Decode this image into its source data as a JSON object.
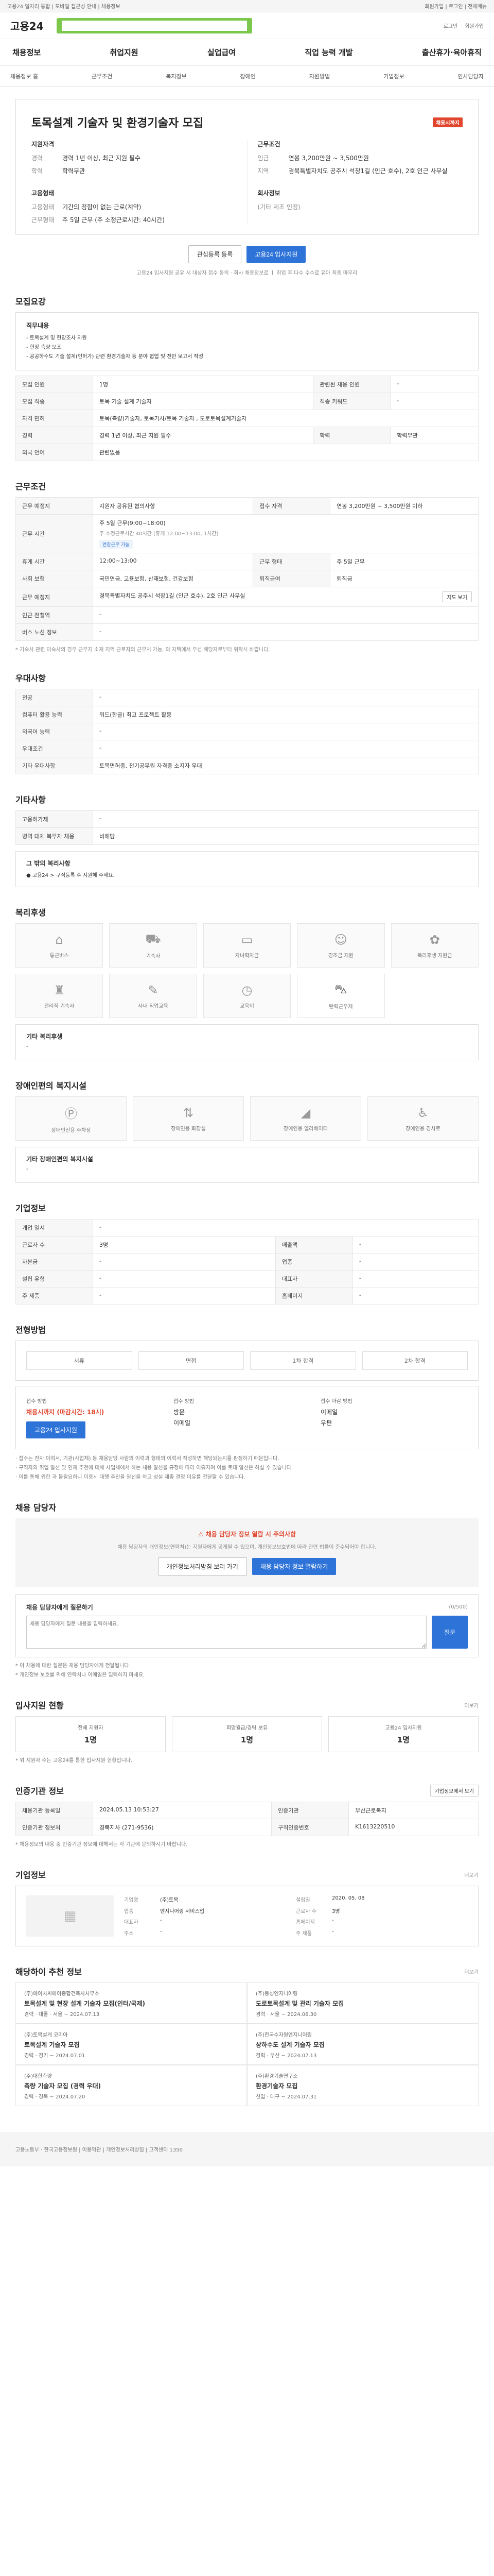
{
  "topbar": {
    "notice": "고용24 일자리 통합 | 모바일 접근성 안내 | 채용정보",
    "right": "회원가입 | 로그인 | 전체메뉴"
  },
  "site": {
    "logo": "고용24",
    "search_placeholder": "",
    "utils": [
      "로그인",
      "회원가입"
    ]
  },
  "gnb": [
    "채용정보",
    "취업지원",
    "실업급여",
    "직업 능력 개발",
    "출산휴가·육아휴직"
  ],
  "subnav": [
    "채용정보 홈",
    "근무조건",
    "복지정보",
    "장애인",
    "지원방법",
    "기업정보",
    "인사담당자"
  ],
  "job": {
    "title": "토목설계 기술자 및 환경기술자 모집",
    "badge": "채용시까지",
    "left_head": "지원자격",
    "left": [
      [
        "경력",
        "경력 1년 이상, 최근 지원 필수"
      ],
      [
        "학력",
        "학력무관"
      ]
    ],
    "right_head": "근무조건",
    "right": [
      [
        "임금",
        "연봉 3,200만원 ~ 3,500만원"
      ],
      [
        "지역",
        "경북특별자치도 공주시 석장1길 (인근 호수), 2호 인근 사무실"
      ]
    ],
    "left2_head": "고용형태",
    "left2": [
      [
        "고용형태",
        "기간의 정함이 없는 근로(계약)"
      ],
      [
        "근무형태",
        "주 5일 근무 (주 소정근로시간: 40시간)"
      ]
    ],
    "right2_head": "회사정보",
    "right2": [
      [
        "",
        "(기타 제조 인정)"
      ]
    ],
    "apply_label": "고용24 입사지원",
    "save_label": "관심등록 등록",
    "note": "고용24 입사지원 공유 시 대상자 접수 동의 · 회사 채용정보로 ㅣ 취업 후 다수 수수료 유아 최종 마무리"
  },
  "recruit": {
    "head": "모집요강",
    "duty_head": "직무내용",
    "duties": [
      "- 토목설계 및 현장조사 지원",
      "- 현장 측량 보조",
      "- 공공하수도 기술 설계(인허가) 관련 환경기술자 등 분야 협업 및 전반 보고서 작성"
    ],
    "rows": [
      [
        "모집 인원",
        "1명",
        "관련된 채용 인원",
        "-"
      ],
      [
        "모집 직종",
        "토목 기술 설계 기술자",
        "직종 키워드",
        "-"
      ],
      [
        "자격 면허",
        "토목(측량)기술자, 토목기사/토목 기술자 , 도로토목설계기술자",
        "",
        ""
      ],
      [
        "경력",
        "경력 1년 이상, 최근 지원 필수",
        "학력",
        "학력무관"
      ],
      [
        "외국 언어",
        "관련없음",
        "",
        ""
      ]
    ]
  },
  "work": {
    "head": "근무조건",
    "rows": [
      [
        "근무 예정지",
        "지원자 공유된 협의사항",
        "접수 자격",
        "연봉 3,200만원 ~ 3,500만원 이하"
      ],
      [
        "근무 시간",
        "주 5일 근무(9:00~18:00)",
        "",
        ""
      ],
      [
        "휴게 시간",
        "12:00~13:00",
        "근무 형태",
        "주 5일 근무"
      ],
      [
        "사회 보험",
        "국민연금, 고용보험, 산재보험, 건강보험",
        "퇴직급여",
        "퇴직금"
      ],
      [
        "근무 예정지",
        "경북특별자치도 공주시 석장1길 (인근 호수), 2호 인근 사무실",
        "",
        ""
      ],
      [
        "인근 전철역",
        "-",
        "",
        ""
      ],
      [
        "버스 노선 정보",
        "-",
        "",
        ""
      ]
    ],
    "sub_text": "주 소정근로시간 40시간 (휴게 12:00~13:00, 1시간)",
    "map_label": "지도 보기",
    "footnote": "* 기숙사 관련 미숙사의 경우 근무지 소재 지역 근로자의 근무처 가능, 의 자택에서 우선 해당자로부터 위탁시 바랍니다.",
    "pill_label": "연장근무 가능"
  },
  "etc": {
    "head": "우대사항",
    "rows": [
      [
        "전공",
        "-"
      ],
      [
        "컴퓨터 활용 능력",
        "워드(한글) 최고 프로젝트 활용"
      ],
      [
        "외국어 능력",
        "-"
      ],
      [
        "우대조건",
        "-"
      ],
      [
        "기타 우대사항",
        "토목면허증, 전기공무원 자격증 소지자 우대"
      ]
    ]
  },
  "other": {
    "head": "기타사항",
    "rows": [
      [
        "고용허가제",
        "-"
      ],
      [
        "병역 대체 복무자 채용",
        "비해당"
      ]
    ],
    "extra_head": "그 밖의 복리사항",
    "extra": "● 고용24 > 구직등록 후 지원해 주세요."
  },
  "welfare": {
    "head": "복리후생",
    "cards": [
      [
        "house-icon",
        "통근버스"
      ],
      [
        "car-icon",
        "기숙사"
      ],
      [
        "card-icon",
        "자녀학자금"
      ],
      [
        "baby-icon",
        "경조금 지원"
      ],
      [
        "gift-icon",
        "복리후생 지원금"
      ],
      [
        "shirt-icon",
        "관리직 기숙사"
      ],
      [
        "pen-icon",
        "사내 직업교육"
      ],
      [
        "clock-icon",
        "교육비"
      ],
      [
        "truck-icon",
        "탄력근무제"
      ]
    ],
    "sub_head": "기타 복리후생",
    "sub_value": "-"
  },
  "disabled": {
    "head": "장애인편의 복지시설",
    "cards": [
      [
        "parking-icon",
        "장애인전용 주차장"
      ],
      [
        "elevator-icon",
        "장애인용 화장실"
      ],
      [
        "ramp-icon",
        "장애인용 엘리베이터"
      ],
      [
        "wheelchair-icon",
        "장애인용 경사로"
      ]
    ],
    "sub_head": "기타 장애인편의 복지시설",
    "sub_value": "-"
  },
  "company": {
    "head": "기업정보",
    "rows": [
      [
        "개업 일시",
        "-",
        "",
        ""
      ],
      [
        "근로자 수",
        "3명",
        "매출액",
        "-"
      ],
      [
        "자본금",
        "-",
        "업종",
        "-"
      ],
      [
        "설립 유형",
        "-",
        "대표자",
        "-"
      ],
      [
        "주 제품",
        "-",
        "홈페이지",
        "-"
      ]
    ]
  },
  "process": {
    "head": "전형방법",
    "steps": [
      "서류",
      "면접",
      "1차 합격",
      "2차 합격"
    ],
    "cols": [
      [
        "접수 방법",
        "채용시까지 (마감시간: 18시)",
        "고용24 입사지원"
      ],
      [
        "접수 방법",
        "방문",
        "이메일"
      ],
      [
        "접수 마감 방법",
        "이메일",
        "우편"
      ]
    ],
    "apply_label": "고용24 입사지원",
    "notes": [
      "· 접수는 전자 이력서, 기관(사업체) 등 채용담당 사람의 이력과 형태의 이력서 작성하면 해당되는지를 판정하기 때문입니다.",
      "· 구직자의 취업 알선 및 인재 추천에 대해 사업체에서 하는 채용 알선을 규정에 따라 이뤄지며 이를 토대 알선은 하실 수 있습니다.",
      "· 이를 통해 위한 과 불필요하니 이용시 대행 추천을 알선을 하고 성실 제출 결정 이유를 전달할 수 있습니다."
    ]
  },
  "contact": {
    "head": "채용 담당자",
    "warn_title": "채용 담당자 정보 열람 시 주의사항",
    "warn_text": "채용 담당자의 개인정보(연락처)는 지원자에게 공개될 수 있으며, 개인정보보호법에 따라 관련 법률이 준수되어야 합니다.",
    "btn1": "개인정보처리방침 보러 가기",
    "btn2": "채용 담당자 정보 열람하기",
    "inquiry_head": "채용 담당자에게 질문하기",
    "inquiry_note": "(0/500)",
    "inquiry_placeholder": "채용 담당자에게 질문 내용을 입력하세요.",
    "inquiry_btn": "질문",
    "notes": [
      "* 이 채용에 대한 질문은 채용 담당자에게 전달됩니다.",
      "* 개인정보 보호를 위해 연락처나 이메일은 입력하지 마세요."
    ]
  },
  "apply_status": {
    "head": "입사지원 현황",
    "more": "더보기",
    "items": [
      [
        "전체 지원자",
        "1명"
      ],
      [
        "희망월급/경력 보유",
        "1명"
      ],
      [
        "고용24 입사지원",
        "1명"
      ]
    ],
    "note": "* 위 지원자 수는 고용24를 통한 입사지원 현황입니다."
  },
  "info": {
    "head": "인증기관 정보",
    "btn": "기업정보에서 보기",
    "rows": [
      [
        "채용기관 등록일",
        "2024.05.13 10:53:27",
        "인증기관",
        "부산근로복지"
      ],
      [
        "인증기관 정보처",
        "경북지사 (271-9536)",
        "구직인증번호",
        "K1613220510"
      ]
    ],
    "note": "* 채용정보의 내용 중 인증기관 정보에 대해서는 각 기관에 문의하시기 바랍니다."
  },
  "company_detail": {
    "head": "기업정보",
    "more": "더보기",
    "labels": [
      "기업명",
      "업종",
      "대표자",
      "주소",
      "주 제품",
      "설립일",
      "근로자 수",
      "홈페이지"
    ],
    "values": [
      "(주)토목",
      "엔지니어링 서비스업",
      "-",
      "-",
      "-",
      "2020. 05. 08",
      "3명",
      "-"
    ]
  },
  "jobs": {
    "head": "해당하이 추천 정보",
    "more": "더보기",
    "list": [
      {
        "org": "(주)에이치씨에이종합건축사사무소",
        "title": "토목설계 및 현장 설계 기술자 모집(인터/국제)",
        "meta": "경력 · 대졸 · 서울",
        "date": "~ 2024.07.13"
      },
      {
        "org": "(주)동성엔지니어링",
        "title": "도로토목설계 및 관리 기술자 모집",
        "meta": "경력 · 서울",
        "date": "~ 2024.06.30"
      },
      {
        "org": "(주)토목설계 코리아",
        "title": "토목설계 기술자 모집",
        "meta": "경력 · 경기",
        "date": "~ 2024.07.01"
      },
      {
        "org": "(주)한국수자원엔지니어링",
        "title": "상하수도 설계 기술자 모집",
        "meta": "경력 · 부산",
        "date": "~ 2024.07.13"
      },
      {
        "org": "(주)대한측량",
        "title": "측량 기술자 모집 (경력 우대)",
        "meta": "경력 · 경북",
        "date": "~ 2024.07.20"
      },
      {
        "org": "(주)환경기술연구소",
        "title": "환경기술자 모집",
        "meta": "신입 · 대구",
        "date": "~ 2024.07.31"
      }
    ]
  },
  "footer": {
    "text": "고용노동부 · 한국고용정보원 | 이용약관 | 개인정보처리방침 | 고객센터 1350"
  }
}
